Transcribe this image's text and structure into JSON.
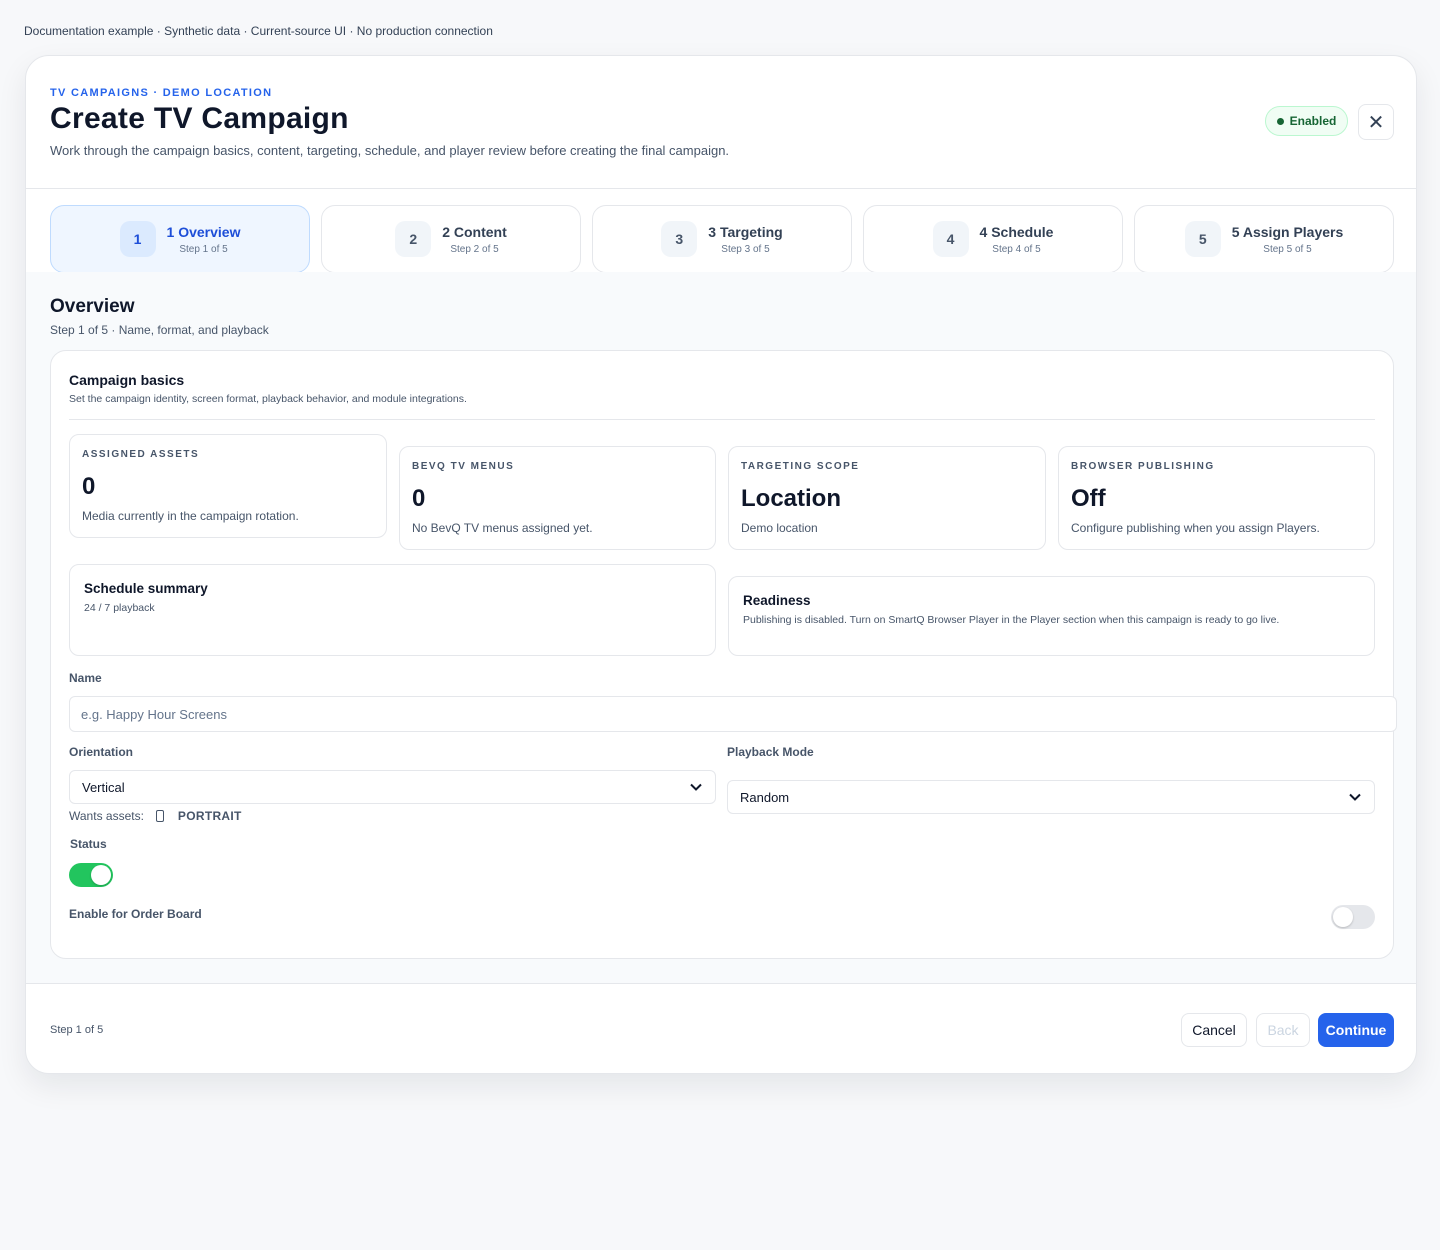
{
  "doc_note": "Documentation example · Synthetic data · Current-source UI · No production connection",
  "header": {
    "eyebrow": "TV CAMPAIGNS · DEMO LOCATION",
    "title": "Create TV Campaign",
    "subtitle": "Work through the campaign basics, content, targeting, schedule, and player review before creating the final campaign.",
    "status_badge": "Enabled",
    "close_icon": "✕"
  },
  "steps": [
    {
      "num": "1",
      "label": "1 Overview",
      "sub": "Step 1 of 5"
    },
    {
      "num": "2",
      "label": "2 Content",
      "sub": "Step 2 of 5"
    },
    {
      "num": "3",
      "label": "3 Targeting",
      "sub": "Step 3 of 5"
    },
    {
      "num": "4",
      "label": "4 Schedule",
      "sub": "Step 4 of 5"
    },
    {
      "num": "5",
      "label": "5 Assign Players",
      "sub": "Step 5 of 5"
    }
  ],
  "section": {
    "title": "Overview",
    "subtitle": "Step 1 of 5 · Name, format, and playback"
  },
  "card": {
    "title": "Campaign basics",
    "subtitle": "Set the campaign identity, screen format, playback behavior, and module integrations."
  },
  "stats": [
    {
      "label": "ASSIGNED ASSETS",
      "value": "0",
      "desc": "Media currently in the campaign rotation."
    },
    {
      "label": "BEVQ TV MENUS",
      "value": "0",
      "desc": "No BevQ TV menus assigned yet."
    },
    {
      "label": "TARGETING SCOPE",
      "value": "Location",
      "desc": "Demo location"
    },
    {
      "label": "BROWSER PUBLISHING",
      "value": "Off",
      "desc": "Configure publishing when you assign Players."
    }
  ],
  "schedule_summary": {
    "title": "Schedule summary",
    "desc": "24 / 7 playback"
  },
  "readiness": {
    "title": "Readiness",
    "desc": "Publishing is disabled. Turn on SmartQ Browser Player in the Player section when this campaign is ready to go live."
  },
  "form": {
    "name_label": "Name",
    "name_value": "",
    "name_placeholder": "e.g. Happy Hour Screens",
    "orientation_label": "Orientation",
    "orientation_value": "Vertical",
    "playback_label": "Playback Mode",
    "playback_value": "Random",
    "wants_assets_label": "Wants assets:",
    "wants_assets_value": "PORTRAIT",
    "status_label": "Status",
    "status_on": true,
    "order_board_label": "Enable for Order Board",
    "order_board_on": false
  },
  "footer": {
    "step_text": "Step 1 of 5",
    "cancel_label": "Cancel",
    "back_label": "Back",
    "continue_label": "Continue"
  },
  "colors": {
    "accent": "#2563eb",
    "toggle_on": "#22c55e",
    "badge_text": "#166534"
  }
}
